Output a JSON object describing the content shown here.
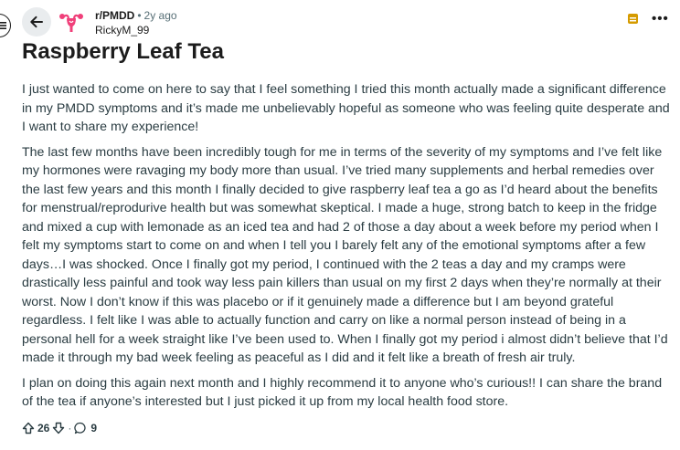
{
  "header": {
    "subreddit": "r/PMDD",
    "separator": "•",
    "age": "2y ago",
    "username": "RickyM_99"
  },
  "post": {
    "title": "Raspberry Leaf Tea",
    "paragraphs": [
      "I just wanted to come on here to say that I feel something I tried this month actually made a significant difference in my PMDD symptoms and it’s made me unbelievably hopeful as someone who was feeling quite desperate and I want to share my experience!",
      "The last few months have been incredibly tough for me in terms of the severity of my symptoms and I’ve felt like my hormones were ravaging my body more than usual. I’ve tried many supplements and herbal remedies over the last few years and this month I finally decided to give raspberry leaf tea a go as I’d heard about the benefits for menstrual/reprodurive health but was somewhat skeptical. I made a huge, strong batch to keep in the fridge and mixed a cup with lemonade as an iced tea and had 2 of those a day about a week before my period when I felt my symptoms start to come on and when I tell you I barely felt any of the emotional symptoms after a few days…I was shocked. Once I finally got my period, I continued with the 2 teas a day and my cramps were drastically less painful and took way less pain killers than usual on my first 2 days when they’re normally at their worst. Now I don’t know if this was placebo or if it genuinely made a difference but I am beyond grateful regardless. I felt like I was able to actually function and carry on like a normal person instead of being in a personal hell for a week straight like I’ve been used to. When I finally got my period i almost didn’t believe that I’d made it through my bad week feeling as peaceful as I did and it felt like a breath of fresh air truly.",
      "I plan on doing this again next month and I highly recommend it to anyone who’s curious!! I can share the brand of the tea if anyone’s interested but I just picked it up from my local health food store."
    ]
  },
  "actions": {
    "upvotes": "26",
    "separator": "·",
    "comments": "9"
  },
  "icons": {
    "menu": "menu-icon",
    "back": "arrow-left-icon",
    "avatar": "uterus-avatar-icon",
    "award": "award-icon",
    "more": "more-horizontal-icon",
    "upvote": "upvote-icon",
    "downvote": "downvote-icon",
    "comment": "comment-icon"
  },
  "colors": {
    "avatar_pink": "#f0407a",
    "award_gold": "#d59b00",
    "meta_gray": "#576f76",
    "body_text": "#2a3c42",
    "back_bg": "#e9ecee"
  },
  "more_label": "•••"
}
